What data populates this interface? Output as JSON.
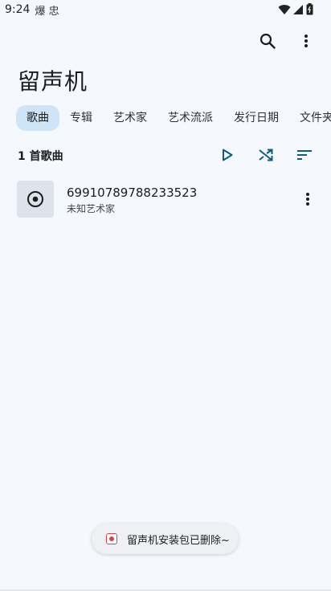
{
  "status_bar": {
    "time": "9:24",
    "notifications": "爆 忠",
    "icons": [
      "wifi-icon",
      "cell-signal-icon",
      "battery-icon"
    ]
  },
  "toolbar": {
    "search_icon": "search-icon",
    "more_icon": "more-vert-icon"
  },
  "app": {
    "title": "留声机"
  },
  "tabs": [
    {
      "label": "歌曲",
      "active": true
    },
    {
      "label": "专辑",
      "active": false
    },
    {
      "label": "艺术家",
      "active": false
    },
    {
      "label": "艺术流派",
      "active": false
    },
    {
      "label": "发行日期",
      "active": false
    },
    {
      "label": "文件夹",
      "active": false
    }
  ],
  "songs_header": {
    "count_label": "1 首歌曲",
    "actions": [
      "play-icon",
      "shuffle-icon",
      "sort-icon"
    ]
  },
  "songs": [
    {
      "title": "69910789788233523",
      "artist": "未知艺术家",
      "cover_icon": "album-disc-icon"
    }
  ],
  "toast": {
    "message": "留声机安装包已删除~"
  },
  "colors": {
    "background": "#f5f9fd",
    "accent": "#0b5c80",
    "tab_active_bg": "#cfe5f7",
    "cover_bg": "#dde3ea"
  }
}
